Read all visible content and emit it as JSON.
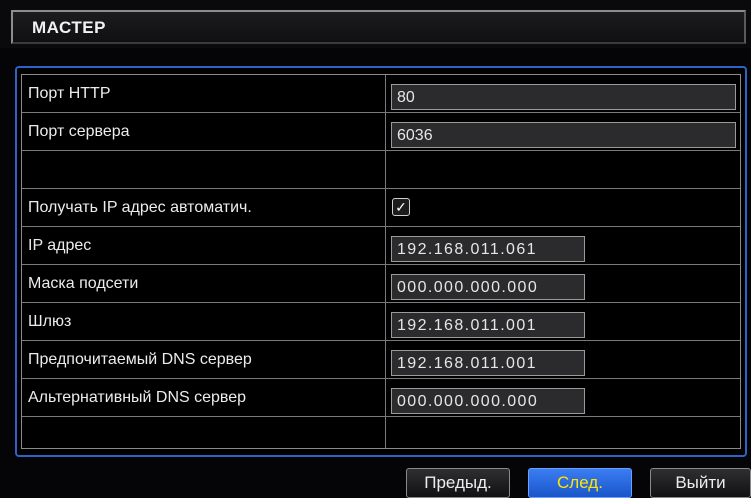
{
  "window": {
    "title": "МАСТЕР"
  },
  "rows": [
    {
      "label": "Порт HTTP",
      "value": "80"
    },
    {
      "label": "Порт сервера",
      "value": "6036"
    },
    {
      "label": "",
      "value": ""
    },
    {
      "label": "Получать IP адрес автоматич.",
      "checked": true,
      "check_glyph": "✓"
    },
    {
      "label": "IP адрес",
      "value": "192.168.011.061"
    },
    {
      "label": "Маска подсети",
      "value": "000.000.000.000"
    },
    {
      "label": "Шлюз",
      "value": "192.168.011.001"
    },
    {
      "label": "Предпочитаемый DNS сервер",
      "value": "192.168.011.001"
    },
    {
      "label": "Альтернативный DNS сервер",
      "value": "000.000.000.000"
    },
    {
      "label": "",
      "value": ""
    }
  ],
  "buttons": {
    "prev": "Предыд.",
    "next": "След.",
    "exit": "Выйти"
  },
  "colors": {
    "accent_border": "#2e62c7",
    "primary_button": "#2f6fe6",
    "primary_text": "#ffe600"
  },
  "icons": {
    "checkbox": "check-icon"
  }
}
